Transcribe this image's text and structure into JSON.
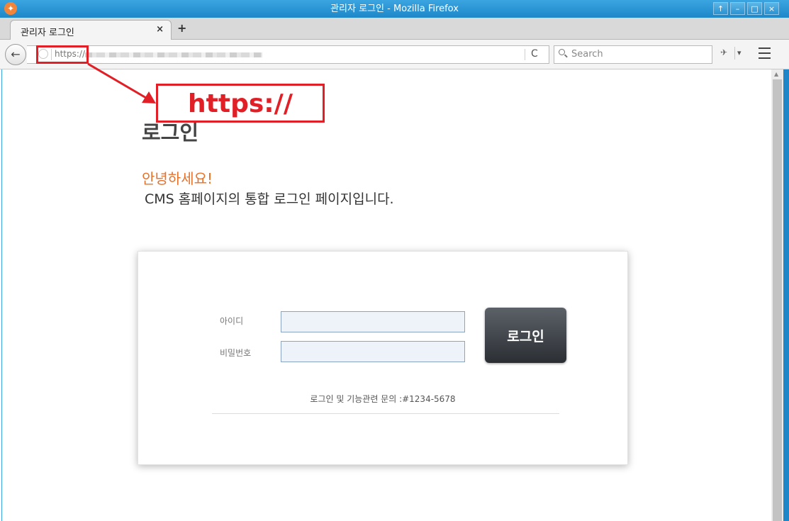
{
  "window": {
    "title": "관리자 로그인 - Mozilla Firefox",
    "controls": [
      "↑",
      "–",
      "□",
      "×"
    ]
  },
  "tab": {
    "title": "관리자 로그인",
    "close": "×"
  },
  "new_tab": "+",
  "nav": {
    "back": "←",
    "url": "https://",
    "reload": "C",
    "search_placeholder": "Search",
    "addon_arrow": "▾"
  },
  "page": {
    "heading": "로그인",
    "greeting": "안녕하세요!",
    "intro": "CMS 홈페이지의 통합 로그인 페이지입니다."
  },
  "login": {
    "id_label": "아이디",
    "pw_label": "비밀번호",
    "button": "로그인",
    "contact": "로그인 및 기능관련 문의 :#1234-5678"
  },
  "annotation": {
    "callout": "https://"
  },
  "colors": {
    "titlebar": "#1d87c9",
    "accent_orange": "#e8712a",
    "annotation_red": "#e11f26",
    "button_dark": "#2b2f34"
  }
}
